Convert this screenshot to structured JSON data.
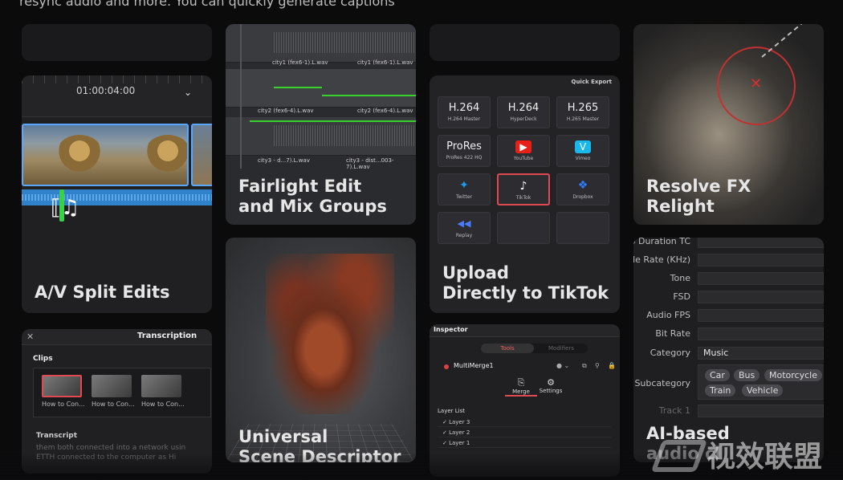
{
  "top_caption": "resync audio and more. You can quickly generate captions",
  "cards": {
    "av_split": {
      "timecode": "01:00:04:00",
      "title_line1": "A/V Split Edits"
    },
    "fairlight": {
      "tracks": [
        {
          "left_label": "city1 (fex6-1).L.wav",
          "right_label": "city1 (fex6-1).L.wav"
        },
        {
          "left_label": "city2 (fex6-4).L.wav",
          "right_label": "city2 (fex6-4).L.wav"
        },
        {
          "left_label": "city3 - d...7).L.wav",
          "right_label": "city3 - dist...003-7).L.wav"
        }
      ],
      "title_line1": "Fairlight Edit",
      "title_line2": "and Mix Groups"
    },
    "usd": {
      "title_line1": "Universal",
      "title_line2": "Scene Descriptor"
    },
    "quick_export": {
      "header": "Quick Export",
      "tiles": [
        {
          "big": "H.264",
          "small": "H.264 Master"
        },
        {
          "big": "H.264",
          "small": "HyperDeck"
        },
        {
          "big": "H.265",
          "small": "H.265 Master"
        },
        {
          "big": "ProRes",
          "small": "ProRes 422 HQ"
        },
        {
          "icon": "youtube-icon",
          "small": "YouTube",
          "color": "#e62117",
          "glyph": "▶"
        },
        {
          "icon": "vimeo-icon",
          "small": "Vimeo",
          "color": "#1ab7ea",
          "glyph": "V"
        },
        {
          "icon": "twitter-icon",
          "small": "Twitter",
          "color": "#1d9bf0",
          "glyph": "🐦"
        },
        {
          "icon": "tiktok-icon",
          "small": "TikTok",
          "color": "#222222",
          "glyph": "♪",
          "active": true
        },
        {
          "icon": "dropbox-icon",
          "small": "Dropbox",
          "color": "#0061ff",
          "glyph": "❖"
        },
        {
          "icon": "replay-icon",
          "small": "Replay",
          "color": "#3a6cff",
          "glyph": "◀◀"
        },
        {
          "small": ""
        },
        {
          "small": ""
        }
      ],
      "title_line1": "Upload",
      "title_line2": "Directly to TikTok"
    },
    "relight": {
      "title_line1": "Resolve FX",
      "title_line2": "Relight"
    },
    "metadata": {
      "rows": [
        {
          "label": "dio Duration TC",
          "value": ""
        },
        {
          "label": "mple Rate (KHz)",
          "value": ""
        },
        {
          "label": "Tone",
          "value": ""
        },
        {
          "label": "FSD",
          "value": ""
        },
        {
          "label": "Audio FPS",
          "value": ""
        },
        {
          "label": "Bit Rate",
          "value": ""
        },
        {
          "label": "Category",
          "value": "Music"
        }
      ],
      "subcategory_label": "Subcategory",
      "subcategory_tags": [
        "Car",
        "Bus",
        "Motorcycle",
        "Train",
        "Vehicle"
      ],
      "track_label": "Track 1",
      "title_line1": "AI-based",
      "title_line2": "audio cl"
    },
    "transcription": {
      "title": "Transcription",
      "clips_label": "Clips",
      "clips": [
        "How to Con...",
        "How to Con...",
        "How to Con..."
      ],
      "transcript_label": "Transcript",
      "transcript_lines": [
        "them both connected into a network usin",
        "ETTH connected to the computer as Hi"
      ]
    },
    "inspector": {
      "title": "Inspector",
      "tabs": [
        "Tools",
        "Modifiers"
      ],
      "node_name": "MultiMerge1",
      "subtabs": [
        "Merge",
        "Settings"
      ],
      "layer_list_label": "Layer List",
      "layers": [
        "Layer 3",
        "Layer 2",
        "Layer 1"
      ]
    }
  },
  "watermark": "视效联盟",
  "colors": {
    "accent_red": "#e04a53",
    "clip_blue": "#5aa7ff",
    "playhead_green": "#3ad14a"
  }
}
